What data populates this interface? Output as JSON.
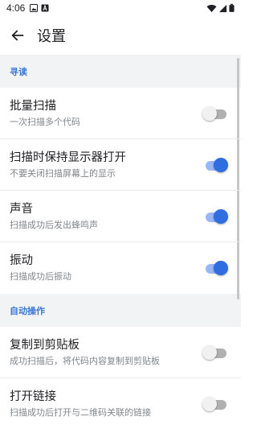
{
  "status_bar": {
    "time": "4:06",
    "icons": [
      "gallery-notification-icon",
      "text-notification-icon",
      "wifi-icon",
      "signal-icon",
      "battery-icon"
    ]
  },
  "app_bar": {
    "back_icon": "arrow-left-icon",
    "title": "设置"
  },
  "sections": [
    {
      "header": "寻读",
      "items": [
        {
          "title": "批量扫描",
          "summary": "一次扫描多个代码",
          "checked": false
        },
        {
          "title": "扫描时保持显示器打开",
          "summary": "不要关闭扫描屏幕上的显示",
          "checked": true
        },
        {
          "title": "声音",
          "summary": "扫描成功后发出蜂鸣声",
          "checked": true
        },
        {
          "title": "振动",
          "summary": "扫描成功后振动",
          "checked": true
        }
      ]
    },
    {
      "header": "自动操作",
      "items": [
        {
          "title": "复制到剪贴板",
          "summary": "成功扫描后，将代码内容复制到剪贴板",
          "checked": false
        },
        {
          "title": "打开链接",
          "summary": "扫描成功后打开与二维码关联的链接",
          "checked": false
        }
      ]
    }
  ],
  "colors": {
    "accent": "#2f6de0",
    "section_header": "#3c78d8",
    "background": "#f1f3f4"
  }
}
